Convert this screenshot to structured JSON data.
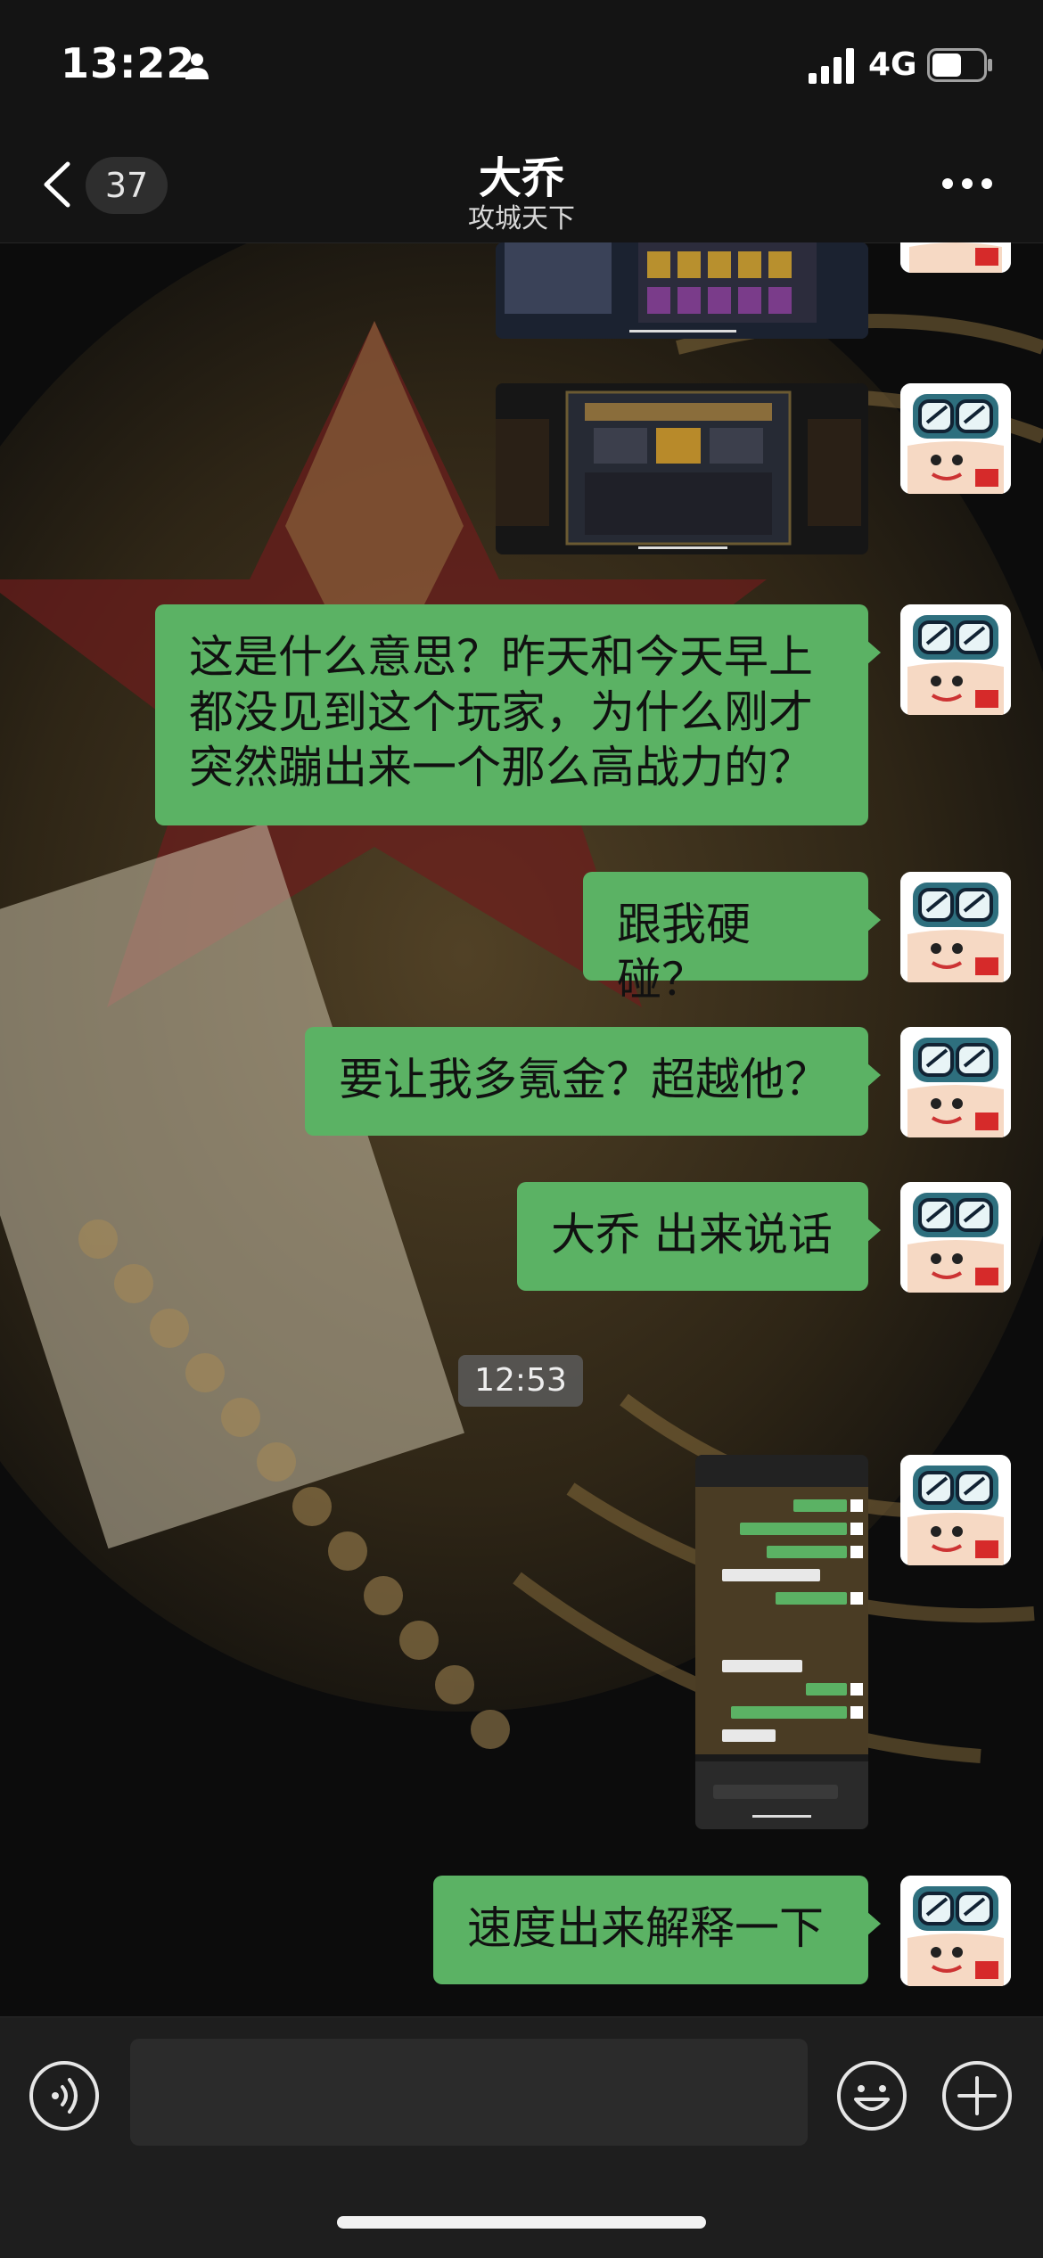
{
  "status": {
    "time": "13:22",
    "network": "4G"
  },
  "header": {
    "back_count": "37",
    "title": "大乔",
    "subtitle": "攻城天下"
  },
  "messages": [
    {
      "type": "image",
      "sender": "me"
    },
    {
      "type": "image",
      "sender": "me"
    },
    {
      "type": "text",
      "sender": "me",
      "text": "这是什么意思？昨天和今天早上都没见到这个玩家，为什么刚才突然蹦出来一个那么高战力的？"
    },
    {
      "type": "text",
      "sender": "me",
      "text": "跟我硬碰？"
    },
    {
      "type": "text",
      "sender": "me",
      "text": "要让我多氪金？超越他？"
    },
    {
      "type": "text",
      "sender": "me",
      "text": "大乔 出来说话"
    },
    {
      "type": "timestamp",
      "text": "12:53"
    },
    {
      "type": "image",
      "sender": "me"
    },
    {
      "type": "text",
      "sender": "me",
      "text": "速度出来解释一下"
    }
  ],
  "colors": {
    "bubble_green": "#5bb264",
    "bar_bg": "#141414",
    "input_bg": "#1e1e1e"
  }
}
